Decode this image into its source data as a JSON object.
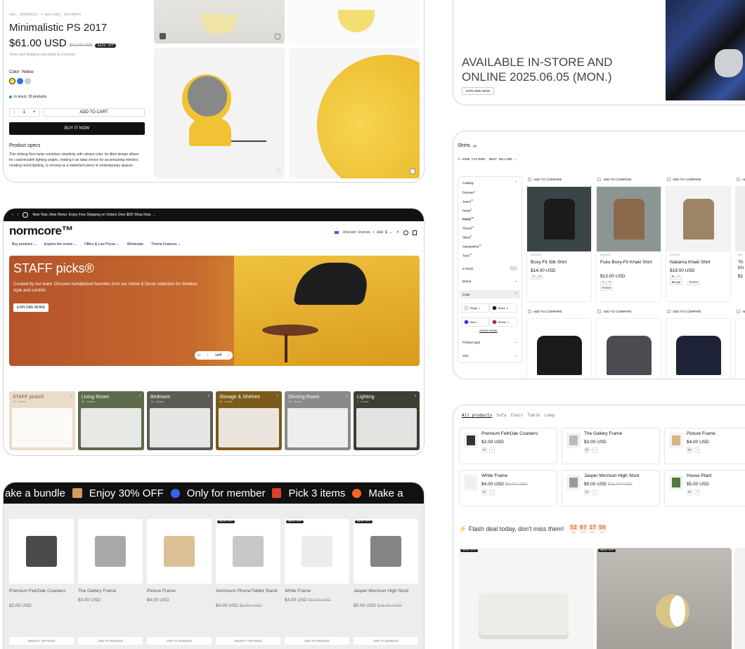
{
  "product": {
    "sku_line": "SKU: SKU00PS17 • Barcode: 9023N544",
    "title": "Minimalistic PS 2017",
    "price": "$61.00 USD",
    "compare_price": "$71.00 USD",
    "sale_badge": "Sale off",
    "tax_note": "Taxes and shipping calculated at checkout",
    "color_label": "Color: Yellow",
    "stock": "In stock: 20 products",
    "qty": "1",
    "add_to_cart": "ADD TO CART",
    "buy_now": "BUY IT NOW",
    "specs_title": "Product specs",
    "description": "This striking floor lamp combines simplicity with vibrant color. Its tilted design allows for customizable lighting angles, making it an ideal choice for accentuating interiors, creating mood lighting, or serving as a statement piece in contemporary spaces."
  },
  "home": {
    "announcement": "New Year, New Home: Enjoy Free Shipping on Orders Over $50! Shop Now. →",
    "logo": "normcore™",
    "nav": [
      "Buy products ⌄",
      "Explore the rooms ⌄",
      "Offers & Low Prices ⌄",
      "Wholesale",
      "Theme Features ⌄"
    ],
    "locale": "United States • USD $ ⌄",
    "hero_title": "STAFF picks®",
    "hero_text": "Curated by our team: Discover handpicked favorites from our Home & Decor collection for timeless style and comfort.",
    "hero_cta": "EXPLORE MORE",
    "slider_count": "1of4",
    "categories": [
      {
        "name": "STAFF picks®",
        "count": "22 items",
        "bg": "#eadccb",
        "fg": "#7a5a3a"
      },
      {
        "name": "Living Room",
        "count": "30 items",
        "bg": "#5d6b4c",
        "fg": "#ffffff"
      },
      {
        "name": "Bedroom",
        "count": "21 items",
        "bg": "#5c5a55",
        "fg": "#ffffff"
      },
      {
        "name": "Storage & Shelves",
        "count": "16 items",
        "bg": "#7b5a1c",
        "fg": "#ffffff"
      },
      {
        "name": "Dinning Room",
        "count": "16 items",
        "bg": "#8a8a88",
        "fg": "#ffffff"
      },
      {
        "name": "Lighting",
        "count": "7 items",
        "bg": "#3c3f31",
        "fg": "#ffffff"
      }
    ]
  },
  "bundle": {
    "marquee": [
      "ake a bundle",
      "Enjoy 30% OFF",
      "Only for member",
      "Pick 3 items",
      "Make a"
    ],
    "products": [
      {
        "name": "Premium Felt/Oak Coasters",
        "price": "$2.00 USD",
        "old": "",
        "badge": "",
        "btn": "SELECT OPTIONS"
      },
      {
        "name": "The Gallery Frame",
        "price": "$3.00 USD",
        "old": "",
        "badge": "",
        "btn": "ADD TO BUNDLE"
      },
      {
        "name": "Picture Frame",
        "price": "$4.00 USD",
        "old": "",
        "badge": "",
        "btn": "ADD TO BUNDLE"
      },
      {
        "name": "Aluminum Phone/Tablet Stand",
        "price": "$4.00 USD",
        "old": "$5.00 USD",
        "badge": "Sale off",
        "btn": "SELECT OPTIONS"
      },
      {
        "name": "White Frame",
        "price": "$4.00 USD",
        "old": "$5.00 USD",
        "badge": "Sale off",
        "btn": "ADD TO BUNDLE"
      },
      {
        "name": "Jasper Morrison High Stool",
        "price": "$5.00 USD",
        "old": "$11.00 USD",
        "badge": "Sale off",
        "btn": "ADD TO BUNDLE"
      }
    ],
    "row2_badges": [
      "Sale off",
      "Sale off",
      "Sale off"
    ]
  },
  "instore": {
    "headline": "AVAILABLE IN-STORE AND ONLINE 2025.06.05 (MON.)",
    "cta": "EXPLORE NOW"
  },
  "shirts": {
    "title": "Shirts",
    "count": "16",
    "hide_filters": "HIDE FILTERS",
    "sort": "BEST SELLING ⌄",
    "catalog_label": "Catalog",
    "catalog": [
      {
        "name": "Dresses",
        "n": "4"
      },
      {
        "name": "Jeans",
        "n": "10"
      },
      {
        "name": "Pants",
        "n": "8"
      },
      {
        "name": "Pants",
        "n": "44"
      },
      {
        "name": "Shorts",
        "n": "12"
      },
      {
        "name": "Skirts",
        "n": "9"
      },
      {
        "name": "Sweatshirts",
        "n": "14"
      },
      {
        "name": "Tees",
        "n": "15"
      }
    ],
    "in_stock": "In stock",
    "brand": "Brand",
    "color": "Color",
    "colors": [
      {
        "name": "Beige",
        "n": "1",
        "hex": "#eee8d4"
      },
      {
        "name": "Black",
        "n": "8",
        "hex": "#111111"
      },
      {
        "name": "Blue",
        "n": "1",
        "hex": "#1f2ee8"
      },
      {
        "name": "Brown",
        "n": "3",
        "hex": "#a8222a"
      }
    ],
    "show_more": "SHOW MORE",
    "product_type": "Product type",
    "size": "Size",
    "compare": "ADD TO COMPARE",
    "products": [
      {
        "brand": "KAIKOU",
        "name": "Boxy-Fit Silk Shirt",
        "price": "$14.00 USD",
        "sizes": [
          "1",
          "2"
        ],
        "colors": []
      },
      {
        "brand": "KAIKOU",
        "name": "Fuku Boxy-Fit Khaki Shirt",
        "price": "$13.00 USD",
        "sizes": [
          "1",
          "2"
        ],
        "colors": [
          "Brown"
        ]
      },
      {
        "brand": "KAIKOU",
        "name": "Nakama Khaki Shirt",
        "price": "$19.00 USD",
        "sizes": [
          "M",
          "L"
        ],
        "colors": [
          "Beige",
          "Green"
        ]
      }
    ],
    "partial": {
      "brand": "KAI",
      "name": "Th Kh",
      "price": "$1"
    }
  },
  "allprod": {
    "tabs": [
      "All products",
      "Sofa",
      "Chair",
      "Table",
      "Lamp"
    ],
    "items": [
      {
        "name": "Premium Felt/Oak Coasters",
        "price": "$2.00 USD",
        "old": ""
      },
      {
        "name": "The Gallery Frame",
        "price": "$3.00 USD",
        "old": ""
      },
      {
        "name": "Picture Frame",
        "price": "$4.00 USD",
        "old": ""
      },
      {
        "name": "White Frame",
        "price": "$4.00 USD",
        "old": "$5.00 USD"
      },
      {
        "name": "Jasper Morrison High Stool",
        "price": "$5.00 USD",
        "old": "$11.00 USD"
      },
      {
        "name": "House Plant",
        "price": "$5.00 USD",
        "old": ""
      }
    ]
  },
  "flash": {
    "text": "⚡ Flash deal today, don't miss them!",
    "countdown": [
      {
        "v": "52",
        "l": "Days"
      },
      {
        "v": "07",
        "l": "Hours"
      },
      {
        "v": "27",
        "l": "Mins"
      },
      {
        "v": "50",
        "l": "Secs"
      }
    ],
    "badges": [
      "Sale off",
      "Sale off"
    ]
  }
}
